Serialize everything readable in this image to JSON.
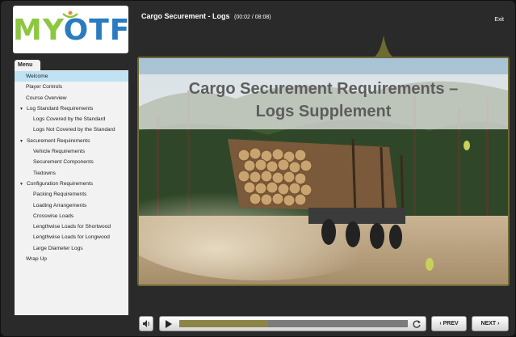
{
  "header": {
    "course_title": "Cargo Securement - Logs",
    "time": "(00:02 / 08:08)",
    "exit_label": "Exit"
  },
  "logo": {
    "text_m": "M",
    "text_y": "Y",
    "text_otf": "OTF"
  },
  "menu": {
    "tab_label": "Menu",
    "items": [
      {
        "label": "Welcome",
        "level": 0,
        "active": true
      },
      {
        "label": "Player Controls",
        "level": 0
      },
      {
        "label": "Course Overview",
        "level": 0
      },
      {
        "label": "Log Standard Requirements",
        "level": "section"
      },
      {
        "label": "Logs Covered by the Standard",
        "level": 1
      },
      {
        "label": "Logs Not Covered by the Standard",
        "level": 1
      },
      {
        "label": "Securement Requirements",
        "level": "section"
      },
      {
        "label": "Vehicle Requirements",
        "level": 1
      },
      {
        "label": "Securement Components",
        "level": 1
      },
      {
        "label": "Tiedowns",
        "level": 1
      },
      {
        "label": "Configuration Requirements",
        "level": "section"
      },
      {
        "label": "Packing Requirements",
        "level": 1
      },
      {
        "label": "Loading Arrangements",
        "level": 1
      },
      {
        "label": "Crosswise Loads",
        "level": 1
      },
      {
        "label": "Lengthwise Loads for Shortwood",
        "level": 1
      },
      {
        "label": "Lengthwise Loads for Longwood",
        "level": 1
      },
      {
        "label": "Large Diameter Logs",
        "level": 1
      },
      {
        "label": "Wrap Up",
        "level": 0
      }
    ]
  },
  "slide": {
    "title_line1": "Cargo Securement Requirements –",
    "title_line2": "Logs Supplement"
  },
  "controls": {
    "prev_label": "PREV",
    "next_label": "NEXT",
    "progress": 0.39
  },
  "colors": {
    "background": "#2a2a2a",
    "accent": "#8c8548",
    "menu_active": "#bfe3f5",
    "logo_green": "#8dc63f",
    "logo_blue": "#2a7bc0"
  }
}
